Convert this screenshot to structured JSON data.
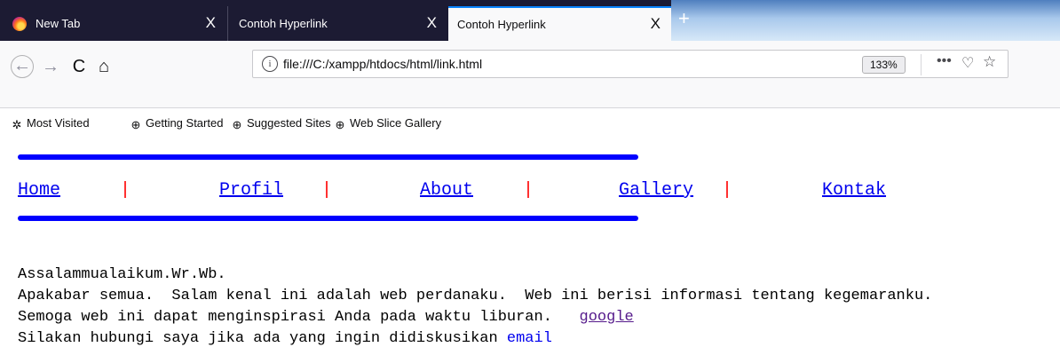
{
  "tabs": [
    {
      "title": "New Tab",
      "close": "X"
    },
    {
      "title": "Contoh Hyperlink",
      "close": "X"
    },
    {
      "title": "Contoh Hyperlink",
      "close": "X"
    }
  ],
  "new_tab": "+",
  "nav": {
    "back": "←",
    "forward": "→",
    "reload": "C",
    "home": "⌂"
  },
  "urlbar": {
    "info": "i",
    "url": "file:///C:/xampp/htdocs/html/link.html",
    "zoom": "133%",
    "more": "•••",
    "pocket": "♡",
    "star": "☆"
  },
  "bookmarks": [
    {
      "label": "Most Visited",
      "icon": "gear-icon"
    },
    {
      "label": "Getting Started",
      "icon": "globe-icon"
    },
    {
      "label": "Suggested Sites",
      "icon": "globe-icon"
    },
    {
      "label": "Web Slice Gallery",
      "icon": "globe-icon"
    }
  ],
  "page": {
    "menu": [
      "Home",
      "Profil",
      "About",
      "Gallery",
      "Kontak"
    ],
    "separator": "|",
    "lines": {
      "l1": "Assalammualaikum.Wr.Wb.",
      "l2": "Apakabar semua.  Salam kenal ini adalah web perdanaku.  Web ini berisi informasi tentang kegemaranku.",
      "l3": "Semoga web ini dapat menginspirasi Anda pada waktu liburan.",
      "l3_gap": "   ",
      "l3_link": "google",
      "l4": "Silakan hubungi saya jika ada yang ingin didiskusikan ",
      "l4_link": "email"
    }
  },
  "colors": {
    "link": "#0000ee",
    "visited": "#551a8b",
    "separator": "#ff0000",
    "rule": "#0000ff"
  }
}
